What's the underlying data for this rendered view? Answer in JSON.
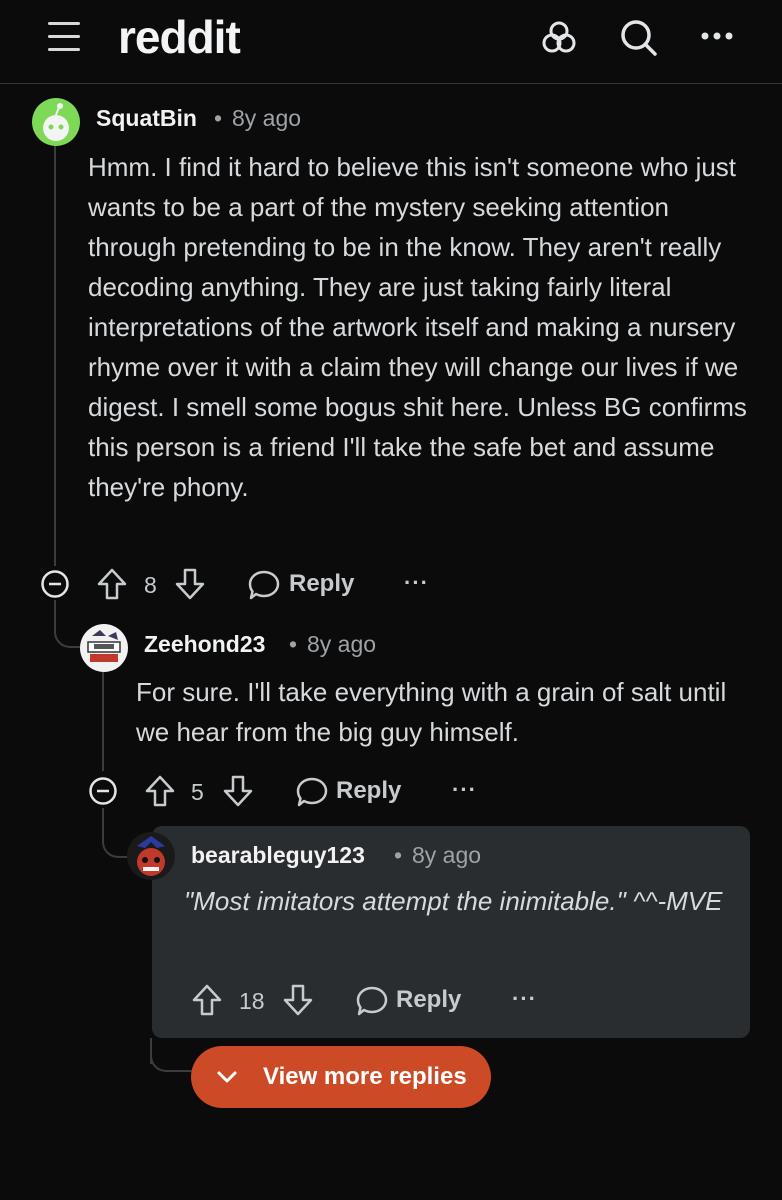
{
  "header": {
    "logo": "reddit",
    "icons": [
      "menu-icon",
      "community-icon",
      "search-icon",
      "more-options-icon"
    ]
  },
  "comments": [
    {
      "username": "SquatBin",
      "separator": "•",
      "time": "8y ago",
      "text": "Hmm. I find it hard to believe this isn't someone who just wants to be a part of the mystery seeking attention through pretending to be in the know. They aren't really decoding anything. They are just taking fairly literal interpretations of the artwork itself and making a nursery rhyme over it with a claim they will change our lives if we digest. I smell some bogus shit here. Unless BG confirms this person is a friend I'll take the safe bet and assume they're phony.",
      "votes": "8",
      "reply_label": "Reply",
      "more": "···"
    },
    {
      "username": "Zeehond23",
      "separator": "•",
      "time": "8y ago",
      "text": "For sure. I'll take everything with a grain of salt until we hear from the big guy himself.",
      "votes": "5",
      "reply_label": "Reply",
      "more": "···"
    },
    {
      "username": "bearableguy123",
      "separator": "•",
      "time": "8y ago",
      "text": "\"Most imitators attempt the inimitable.\" ^^-MVE",
      "votes": "18",
      "reply_label": "Reply",
      "more": "···"
    }
  ],
  "view_more_label": "View more replies",
  "colors": {
    "accent": "#cc4a25",
    "background": "#0b0b0c",
    "highlight_card": "#2a2d2f"
  }
}
